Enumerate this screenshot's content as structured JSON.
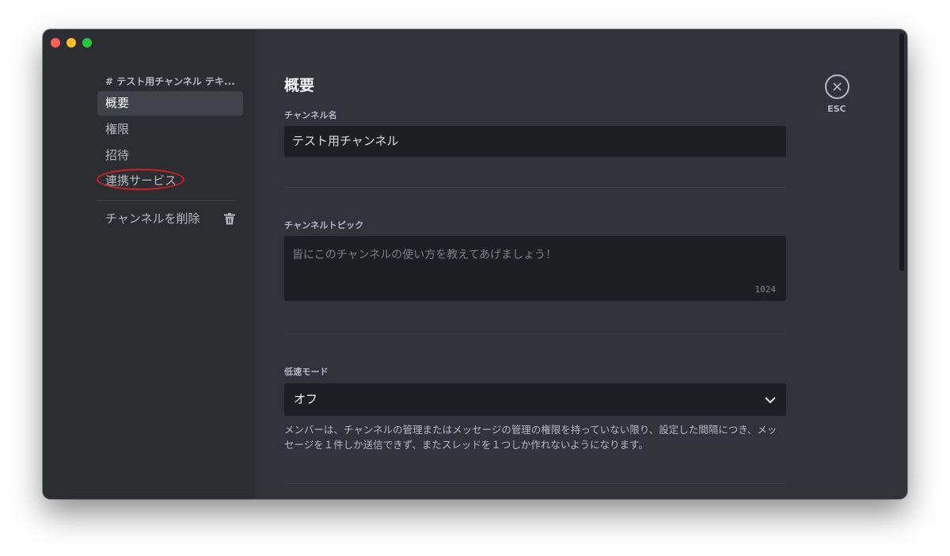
{
  "sidebar": {
    "header": "# テスト用チャンネル テキ...",
    "items": [
      {
        "label": "概要"
      },
      {
        "label": "権限"
      },
      {
        "label": "招待"
      },
      {
        "label": "連携サービス"
      }
    ],
    "delete_label": "チャンネルを削除"
  },
  "main": {
    "title": "概要",
    "channel_name": {
      "label": "チャンネル名",
      "value": "テスト用チャンネル"
    },
    "topic": {
      "label": "チャンネルトピック",
      "placeholder": "皆にこのチャンネルの使い方を教えてあげましょう！",
      "count": "1024"
    },
    "slowmode": {
      "label": "低速モード",
      "value": "オフ",
      "description": "メンバーは、チャンネルの管理またはメッセージの管理の権限を持っていない限り、設定した間隔につき、メッセージを１件しか送信できず、またスレッドを１つしか作れないようになります。"
    },
    "esc": {
      "label": "ESC"
    }
  },
  "colors": {
    "active_item_bg": "#404249",
    "highlight_circle": "#d0202a",
    "window_bg": "#313338",
    "sidebar_bg": "#2b2d31",
    "input_bg": "#1e1f22"
  }
}
